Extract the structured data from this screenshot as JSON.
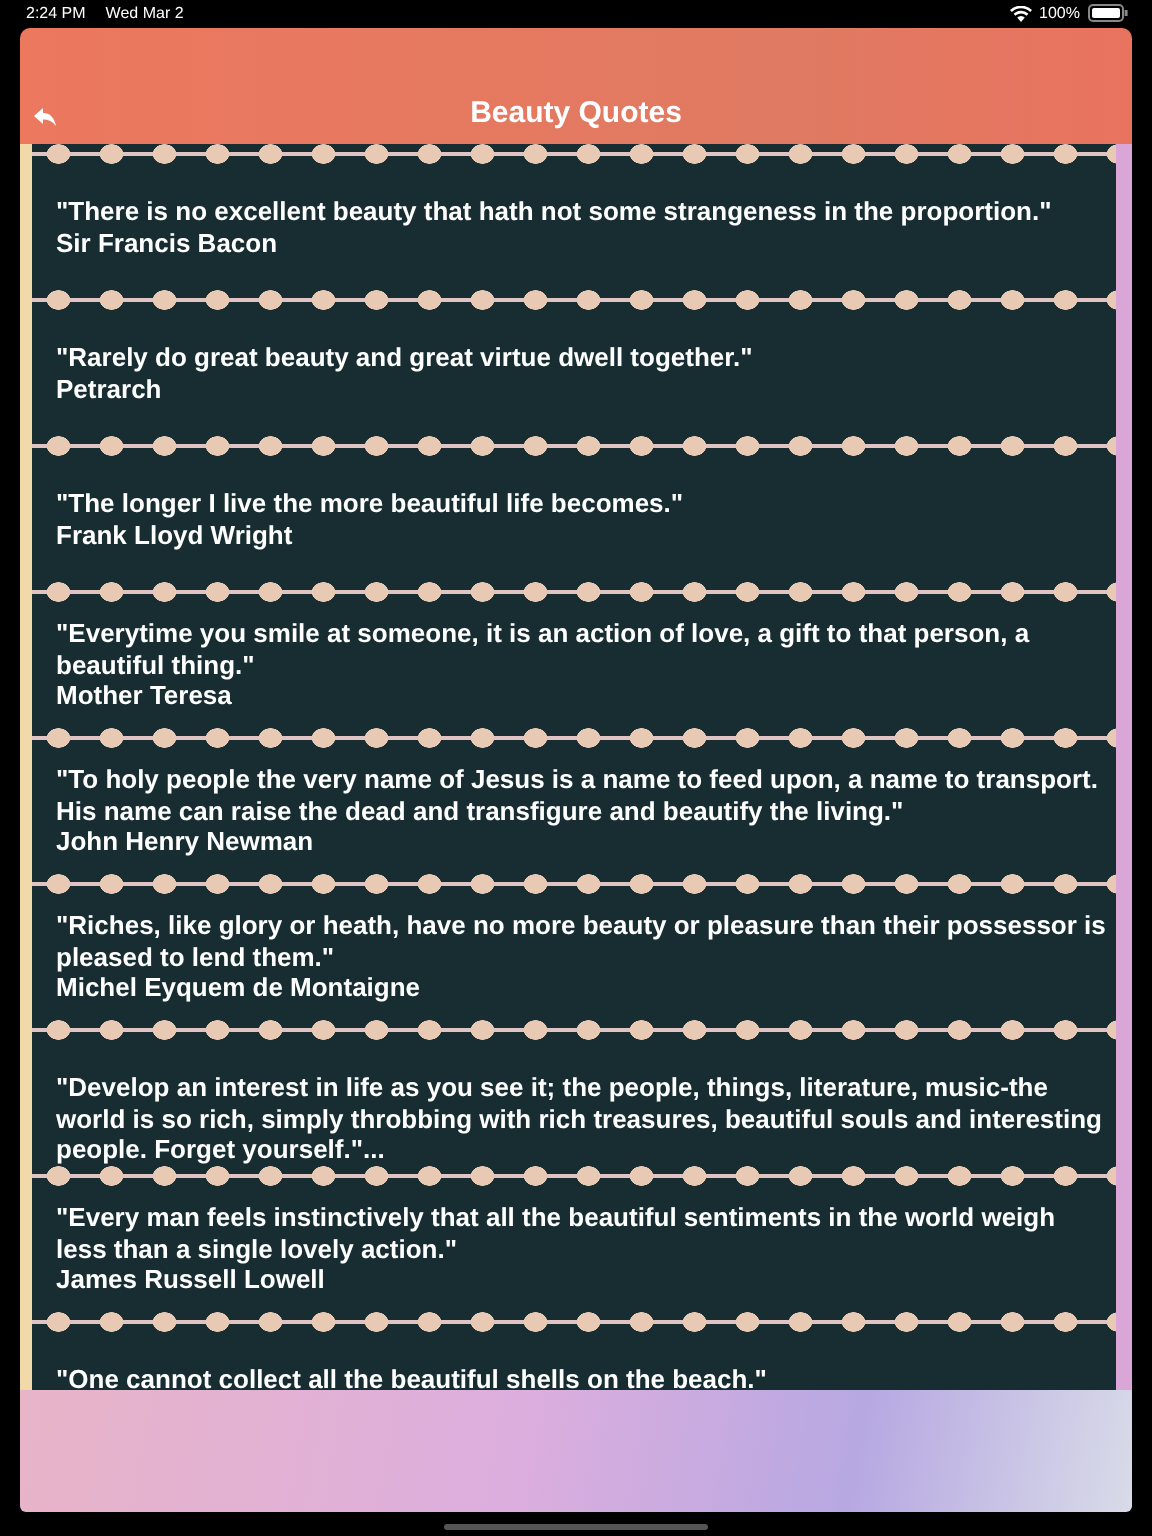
{
  "status_bar": {
    "time": "2:24 PM",
    "date": "Wed Mar 2",
    "battery": "100%"
  },
  "header": {
    "title": "Beauty Quotes"
  },
  "quotes": [
    {
      "text": "\"There is no excellent beauty that hath not some strangeness in the proportion.\"",
      "author": "Sir Francis Bacon"
    },
    {
      "text": "\"Rarely do great beauty and great virtue dwell together.\"",
      "author": "Petrarch"
    },
    {
      "text": "\"The longer I live the more beautiful life becomes.\"",
      "author": "Frank Lloyd Wright"
    },
    {
      "text": "\"Everytime you smile at someone, it is an action of love, a gift to that person, a beautiful thing.\"",
      "author": "Mother Teresa"
    },
    {
      "text": "\"To holy people the very name of Jesus is a name to feed upon, a name to transport. His name can raise the dead and transfigure and beautify the living.\"",
      "author": "John Henry Newman"
    },
    {
      "text": "\"Riches, like glory or heath, have no more beauty or pleasure than their possessor is pleased to lend them.\"",
      "author": "Michel Eyquem de Montaigne"
    },
    {
      "text": "\"Develop an interest in life as you see it; the people, things, literature, music-the world is so rich, simply throbbing with rich treasures, beautiful souls and interesting people. Forget yourself.\"..."
    },
    {
      "text": "\"Every man feels instinctively that all the beautiful sentiments in the world weigh less than a single lovely action.\"",
      "author": "James Russell Lowell"
    },
    {
      "text": "\"One cannot collect all the beautiful shells on the beach.\""
    }
  ]
}
